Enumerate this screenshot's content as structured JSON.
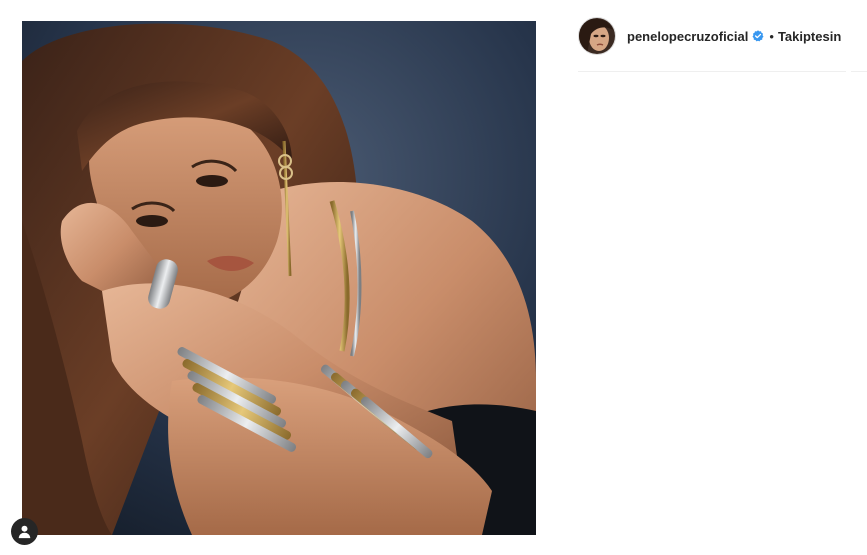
{
  "post": {
    "media_alt": ""
  },
  "author": {
    "username": "penelopecruzoficial",
    "verified": true,
    "separator": "•",
    "follow_state": "Takiptesin"
  },
  "icons": {
    "verified": "verified-badge-icon",
    "user_tag": "user-tag-icon"
  },
  "colors": {
    "text_primary": "#262626",
    "verified_blue": "#3897f0",
    "divider": "#efefef",
    "background": "#ffffff"
  }
}
